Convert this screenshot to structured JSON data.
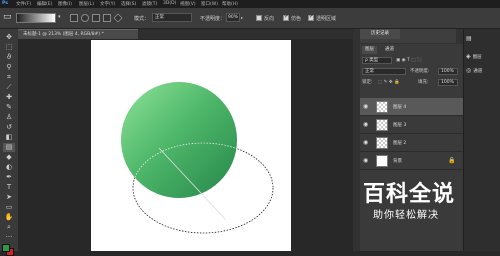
{
  "menu": {
    "items": [
      "文件(F)",
      "编辑(E)",
      "图像(I)",
      "图层(L)",
      "文字(Y)",
      "选择(S)",
      "滤镜(T)",
      "3D(D)",
      "视图(V)",
      "窗口(W)",
      "帮助(H)"
    ]
  },
  "options": {
    "mode_label": "模式：",
    "mode_value": "正常",
    "opacity_label": "不透明度：",
    "opacity_value": "90%",
    "reverse_label": "反向",
    "dither_label": "仿色",
    "transparency_label": "透明区域"
  },
  "document": {
    "tab_title": "未标题-1 @ 213% (图层 4, RGB/8#) *"
  },
  "history": {
    "tab_label": "历史记录"
  },
  "layers_panel": {
    "tabs": [
      "图层",
      "通道"
    ],
    "kind_label": "ρ 类型",
    "blend_mode": "正常",
    "opacity_label": "不透明度:",
    "opacity_value": "100%",
    "lock_label": "锁定:",
    "fill_label": "填充:",
    "fill_value": "100%",
    "layers": [
      {
        "name": "图层 4",
        "selected": true
      },
      {
        "name": "图层 3",
        "selected": false
      },
      {
        "name": "图层 2",
        "selected": false
      },
      {
        "name": "背景",
        "selected": false
      }
    ]
  },
  "right_icons": {
    "layers_label": "图层",
    "channels_label": "通道"
  },
  "watermark": {
    "title": "百科全说",
    "subtitle": "助你轻松解决"
  },
  "colors": {
    "sphere_light": "#8fe39a",
    "sphere_dark": "#2a8f4a",
    "foreground": "#2f9a46",
    "background": "#d42020"
  }
}
